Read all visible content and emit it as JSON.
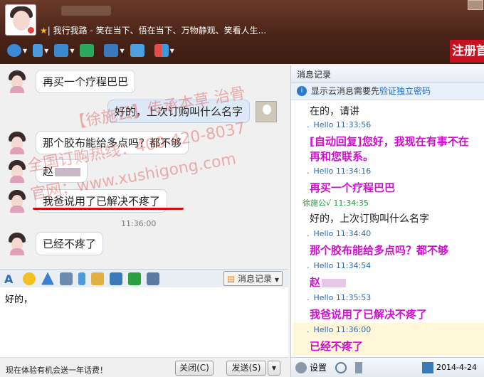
{
  "header": {
    "signature": "| 我行我路 - 笑在当下、悟在当下、万物静观、笑看人生...",
    "register_label": "注册首"
  },
  "chat": {
    "messages": [
      {
        "side": "left",
        "text": "再买一个疗程巴巴"
      },
      {
        "side": "right",
        "text": "好的，上次订购叫什么名字"
      },
      {
        "side": "left",
        "text": "那个胶布能给多点吗？都不够"
      },
      {
        "side": "left",
        "text": "赵"
      },
      {
        "side": "left",
        "text": "我爸说用了已解决不疼了"
      },
      {
        "side": "left",
        "text": "已经不疼了"
      }
    ],
    "time_divider": "11:36:00",
    "watermarks": [
      "【徐施公】传承本草 治骨",
      "全国订购热线：400-420-8037",
      "官网：www.xushigong.com"
    ]
  },
  "input_toolbar": {
    "history_label": "消息记录"
  },
  "input": {
    "value": "好的，"
  },
  "bottom": {
    "promo": "现在体验有机会送一年话费！",
    "close_label": "关闭(C)",
    "send_label": "发送(S)"
  },
  "history": {
    "title": "消息记录",
    "notice": "显示云消息需要先",
    "notice_link": "验证独立密码",
    "entries": [
      {
        "kind": "text",
        "text": "在的，请讲"
      },
      {
        "kind": "meta",
        "name": "Hello",
        "time": "11:33:56"
      },
      {
        "kind": "pink",
        "text": "[自动回复]您好，我现在有事不在"
      },
      {
        "kind": "pink",
        "text": "再和您联系。"
      },
      {
        "kind": "meta",
        "name": "Hello",
        "time": "11:34:16"
      },
      {
        "kind": "pink",
        "text": "再买一个疗程巴巴"
      },
      {
        "kind": "meta2",
        "name": "徐施公√",
        "time": "11:34:35"
      },
      {
        "kind": "text",
        "text": "好的，上次订购叫什么名字"
      },
      {
        "kind": "meta",
        "name": "Hello",
        "time": "11:34:40"
      },
      {
        "kind": "pink",
        "text": "那个胶布能给多点吗？都不够"
      },
      {
        "kind": "meta",
        "name": "Hello",
        "time": "11:34:54"
      },
      {
        "kind": "pink",
        "text": "赵"
      },
      {
        "kind": "meta",
        "name": "Hello",
        "time": "11:35:53"
      },
      {
        "kind": "pink",
        "text": "我爸说用了已解决不疼了"
      },
      {
        "kind": "meta",
        "name": "Hello",
        "time": "11:36:00",
        "highlight": true
      },
      {
        "kind": "pink",
        "text": "已经不疼了",
        "highlight": true
      }
    ],
    "footer": {
      "settings_label": "设置",
      "date": "2014-4-24"
    }
  }
}
